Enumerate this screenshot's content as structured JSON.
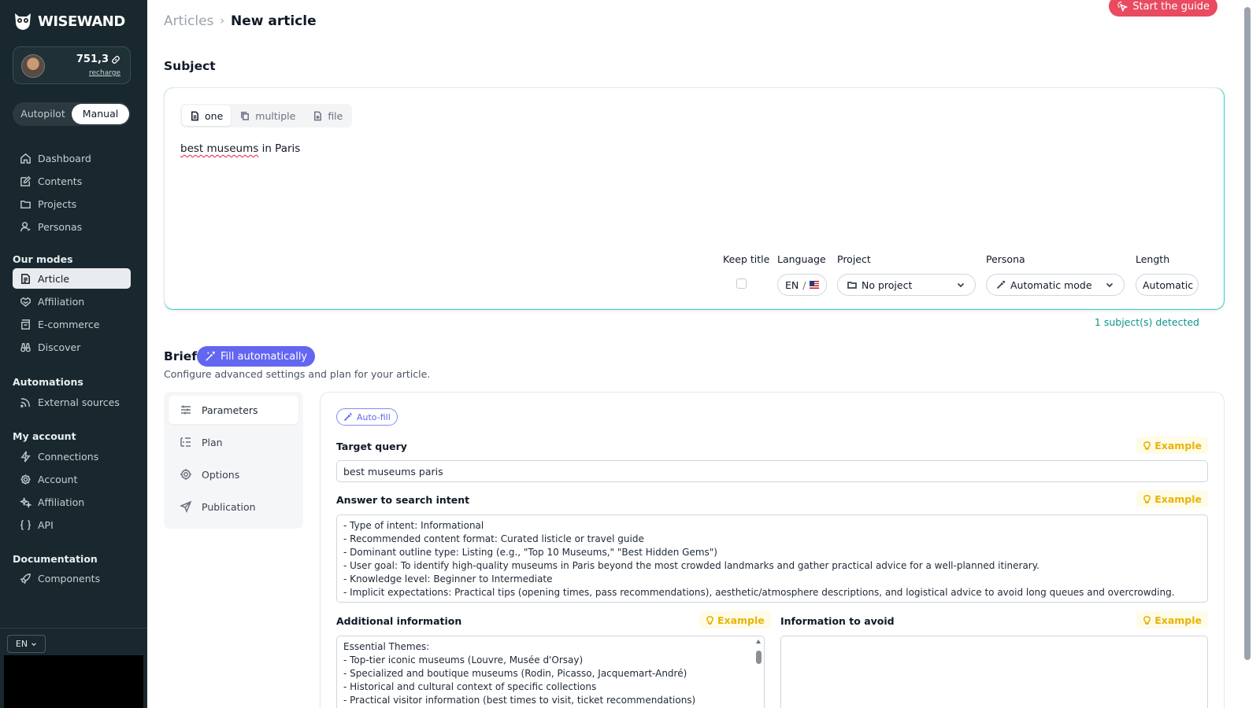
{
  "app": {
    "brand": "WISEWAND"
  },
  "account": {
    "credits": "751,3",
    "recharge": "recharge"
  },
  "mode_toggle": {
    "autopilot": "Autopilot",
    "manual": "Manual",
    "active": "manual"
  },
  "nav": {
    "main": [
      {
        "label": "Dashboard",
        "icon": "home-icon"
      },
      {
        "label": "Contents",
        "icon": "edit-icon"
      },
      {
        "label": "Projects",
        "icon": "folder-icon"
      },
      {
        "label": "Personas",
        "icon": "person-icon"
      }
    ],
    "modes_title": "Our modes",
    "modes": [
      {
        "label": "Article",
        "icon": "document-icon",
        "active": true
      },
      {
        "label": "Affiliation",
        "icon": "handshake-icon"
      },
      {
        "label": "E-commerce",
        "icon": "shopping-bag-icon"
      },
      {
        "label": "Discover",
        "icon": "binoculars-icon"
      }
    ],
    "automations_title": "Automations",
    "automations": [
      {
        "label": "External sources",
        "icon": "rss-icon"
      }
    ],
    "account_title": "My account",
    "account": [
      {
        "label": "Connections",
        "icon": "lightning-icon"
      },
      {
        "label": "Account",
        "icon": "gear-icon"
      },
      {
        "label": "Affiliation",
        "icon": "sparkles-icon"
      },
      {
        "label": "API",
        "icon": "braces-icon"
      }
    ],
    "docs_title": "Documentation",
    "docs": [
      {
        "label": "Components",
        "icon": "rocket-icon"
      }
    ]
  },
  "language_selector": {
    "value": "EN"
  },
  "header": {
    "breadcrumb": [
      "Articles",
      "New article"
    ],
    "guide_button": "Start the guide"
  },
  "subject": {
    "title": "Subject",
    "tabs": [
      "one",
      "multiple",
      "file"
    ],
    "active_tab": "one",
    "text_part1": "best museums",
    "text_part2": " in Paris",
    "keep_title_label": "Keep title",
    "language_label": "Language",
    "language_value": "EN",
    "language_separator": "/",
    "project_label": "Project",
    "project_value": "No project",
    "persona_label": "Persona",
    "persona_value": "Automatic mode",
    "length_label": "Length",
    "length_value": "Automatic",
    "detected": "1 subject(s) detected"
  },
  "brief": {
    "title": "Brief",
    "fill_button": "Fill automatically",
    "subtitle": "Configure advanced settings and plan for your article.",
    "tabs": [
      {
        "label": "Parameters",
        "icon": "sliders-icon",
        "active": true
      },
      {
        "label": "Plan",
        "icon": "list-tree-icon"
      },
      {
        "label": "Options",
        "icon": "gear-icon"
      },
      {
        "label": "Publication",
        "icon": "send-icon"
      }
    ],
    "autofill_label": "Auto-fill",
    "example_label": "Example",
    "target_query_label": "Target query",
    "target_query_value": "best museums paris",
    "search_intent_label": "Answer to search intent",
    "search_intent_lines": [
      "- Type of intent: Informational",
      "- Recommended content format: Curated listicle or travel guide",
      "- Dominant outline type: Listing (e.g., \"Top 10 Museums,\" \"Best Hidden Gems\")",
      "- User goal: To identify high-quality museums in Paris beyond the most crowded landmarks and gather practical advice for a well-planned itinerary.",
      "- Knowledge level: Beginner to Intermediate",
      "- Implicit expectations: Practical tips (opening times, pass recommendations), aesthetic/atmosphere descriptions, and logistical advice to avoid long queues and overcrowding."
    ],
    "additional_info_label": "Additional information",
    "additional_info_lines": [
      "Essential Themes:",
      "- Top-tier iconic museums (Louvre, Musée d'Orsay)",
      "- Specialized and boutique museums (Rodin, Picasso, Jacquemart-André)",
      "- Historical and cultural context of specific collections",
      "- Practical visitor information (best times to visit, ticket recommendations)"
    ],
    "avoid_label": "Information to avoid",
    "avoid_value": ""
  },
  "colors": {
    "sidebar_bg": "#18282e",
    "accent_teal": "#2dd4bf",
    "guide_red": "#e84a5f",
    "fill_indigo": "#6366f1",
    "example_yellow": "#eab308"
  }
}
